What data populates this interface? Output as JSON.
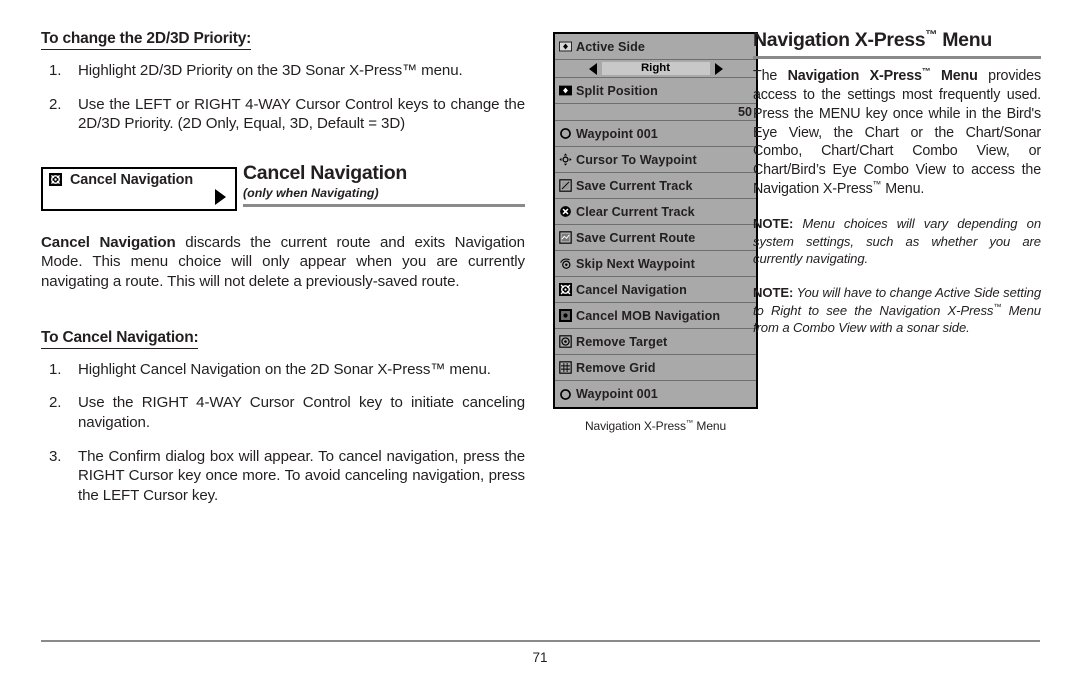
{
  "page": {
    "number": "71"
  },
  "left": {
    "section1": {
      "heading": "To change the 2D/3D Priority:",
      "steps": [
        {
          "num": "1.",
          "text": "Highlight 2D/3D Priority on the 3D Sonar X-Press™ menu."
        },
        {
          "num": "2.",
          "text": "Use the LEFT or RIGHT 4-WAY Cursor Control keys to change the 2D/3D Priority. (2D Only, Equal, 3D, Default = 3D)"
        }
      ]
    },
    "widget": {
      "label": "Cancel Navigation",
      "icon": "cancel-navigation-icon",
      "arrow": "right-triangle-icon"
    },
    "heading_block": {
      "title": "Cancel Navigation",
      "subtitle": "(only when Navigating)"
    },
    "paragraph": {
      "bold_lead": "Cancel Navigation",
      "rest": " discards the current route and exits Navigation Mode. This menu choice will only appear when you are currently navigating a route. This will not delete a previously-saved route."
    },
    "section2": {
      "heading": "To Cancel Navigation:",
      "steps": [
        {
          "num": "1.",
          "text": "Highlight Cancel Navigation on the 2D Sonar X-Press™ menu."
        },
        {
          "num": "2.",
          "text": "Use the RIGHT 4-WAY Cursor Control key to initiate canceling navigation."
        },
        {
          "num": "3.",
          "text": "The Confirm dialog box will appear. To cancel navigation, press the RIGHT Cursor key once more. To avoid canceling navigation, press the LEFT Cursor key."
        }
      ]
    }
  },
  "menu": {
    "caption_pre": "Navigation X-Press",
    "caption_post": " Menu",
    "rows": [
      {
        "kind": "item",
        "label": "Active Side",
        "icon": "left-right-arrows-icon"
      },
      {
        "kind": "value",
        "value": "Right"
      },
      {
        "kind": "item",
        "label": "Split Position",
        "icon": "left-right-arrows-icon"
      },
      {
        "kind": "num",
        "value": "50"
      },
      {
        "kind": "item",
        "label": "Waypoint 001",
        "icon": "circle-waypoint-icon"
      },
      {
        "kind": "item",
        "label": "Cursor To Waypoint",
        "icon": "crosshair-icon"
      },
      {
        "kind": "item",
        "label": "Save Current Track",
        "icon": "save-track-icon"
      },
      {
        "kind": "item",
        "label": "Clear Current Track",
        "icon": "circle-x-icon"
      },
      {
        "kind": "item",
        "label": "Save Current Route",
        "icon": "save-route-icon"
      },
      {
        "kind": "item",
        "label": "Skip Next Waypoint",
        "icon": "skip-waypoint-icon"
      },
      {
        "kind": "item",
        "label": "Cancel Navigation",
        "icon": "cancel-navigation-icon"
      },
      {
        "kind": "item",
        "label": "Cancel MOB Navigation",
        "icon": "cancel-mob-icon"
      },
      {
        "kind": "item",
        "label": "Remove Target",
        "icon": "target-icon"
      },
      {
        "kind": "item",
        "label": "Remove Grid",
        "icon": "grid-icon"
      },
      {
        "kind": "item",
        "label": "Waypoint 001",
        "icon": "circle-waypoint-icon"
      }
    ]
  },
  "right": {
    "title_pre": "Navigation X-Press",
    "title_post": " Menu",
    "para": {
      "p1": "The ",
      "b1_pre": "Navigation X-Press",
      "b1_post": " Menu",
      "p2": " provides access to the settings most frequently used. Press the MENU key once while in the Bird's Eye View, the Chart or the Chart/Sonar Combo, Chart/Chart Combo View, or Chart/Bird’s Eye Combo View to access the Navigation X-Press",
      "p3": " Menu."
    },
    "note1": {
      "label": "NOTE:",
      "text": " Menu choices will vary depending on system settings, such as whether you are currently navigating."
    },
    "note2": {
      "label": "NOTE:",
      "pre": " You will have to change Active Side setting to Right to see the Navigation X-Press",
      "post": " Menu from a Combo View with a sonar side."
    }
  },
  "colors": {
    "menu_bg": "#a9a9a9",
    "menu_value_bg": "#c8c8c8",
    "rule_gray": "#8a8a8a",
    "text": "#231f20"
  }
}
